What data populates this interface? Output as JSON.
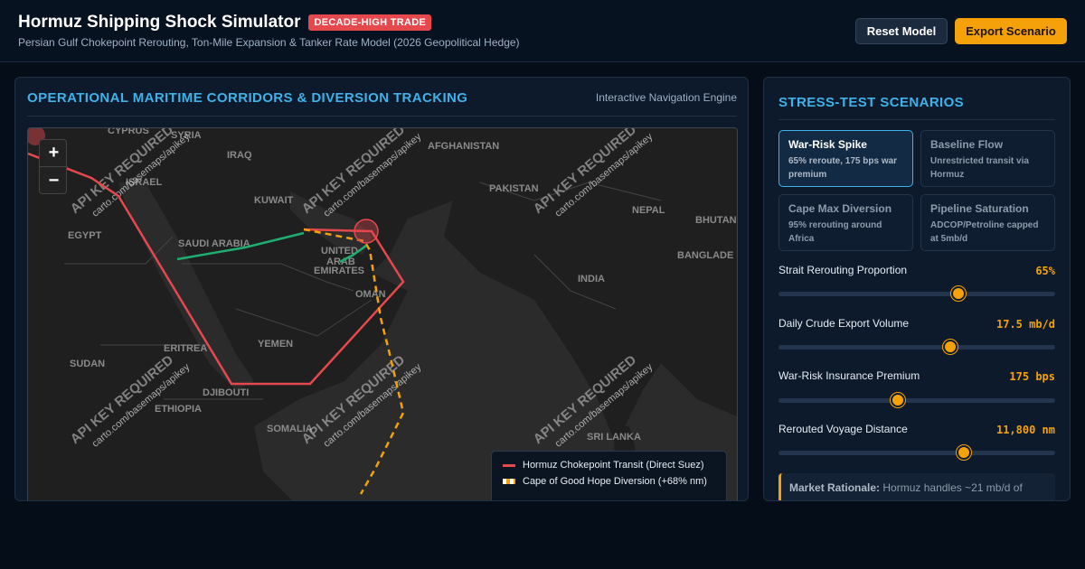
{
  "header": {
    "title": "Hormuz Shipping Shock Simulator",
    "badge": "DECADE-HIGH TRADE",
    "subtitle": "Persian Gulf Chokepoint Rerouting, Ton-Mile Expansion & Tanker Rate Model (2026 Geopolitical Hedge)",
    "reset_label": "Reset Model",
    "export_label": "Export Scenario"
  },
  "map_panel": {
    "title": "OPERATIONAL MARITIME CORRIDORS & DIVERSION TRACKING",
    "subtitle": "Interactive Navigation Engine",
    "zoom_in": "+",
    "zoom_out": "−",
    "watermark_main": "API KEY REQUIRED",
    "watermark_sub": "carto.com/basemaps/apikey",
    "countries": [
      "CYPRUS",
      "SYRIA",
      "IRAQ",
      "AFGHANISTAN",
      "ISRAEL",
      "KUWAIT",
      "PAKISTAN",
      "NEPAL",
      "BHUTAN",
      "EGYPT",
      "SAUDI ARABIA",
      "UNITED ARAB EMIRATES",
      "BANGLADE",
      "INDIA",
      "OMAN",
      "ERITREA",
      "YEMEN",
      "SUDAN",
      "DJIBOUTI",
      "ETHIOPIA",
      "SOMALIA",
      "SRI LANKA"
    ],
    "legend": [
      {
        "label": "Hormuz Chokepoint Transit (Direct Suez)",
        "color": "#e5484d"
      },
      {
        "label": "Cape of Good Hope Diversion (+68% nm)",
        "color": "#f5a20a"
      }
    ],
    "colors": {
      "suez_route": "#e5484d",
      "cape_route": "#f5a20a",
      "pipeline": "#1fae6f"
    }
  },
  "scenarios_panel": {
    "title": "STRESS-TEST SCENARIOS",
    "scenarios": [
      {
        "name": "War-Risk Spike",
        "desc": "65% reroute, 175 bps war premium",
        "active": true
      },
      {
        "name": "Baseline Flow",
        "desc": "Unrestricted transit via Hormuz",
        "active": false
      },
      {
        "name": "Cape Max Diversion",
        "desc": "95% rerouting around Africa",
        "active": false
      },
      {
        "name": "Pipeline Saturation",
        "desc": "ADCOP/Petroline capped at 5mb/d",
        "active": false
      }
    ],
    "sliders": [
      {
        "label": "Strait Rerouting Proportion",
        "value": "65%",
        "fraction": 0.65
      },
      {
        "label": "Daily Crude Export Volume",
        "value": "17.5 mb/d",
        "fraction": 0.62
      },
      {
        "label": "War-Risk Insurance Premium",
        "value": "175 bps",
        "fraction": 0.43
      },
      {
        "label": "Rerouted Voyage Distance",
        "value": "11,800 nm",
        "fraction": 0.67
      }
    ],
    "rationale_label": "Market Rationale:",
    "rationale_text": "Hormuz handles ~21 mb/d of"
  }
}
